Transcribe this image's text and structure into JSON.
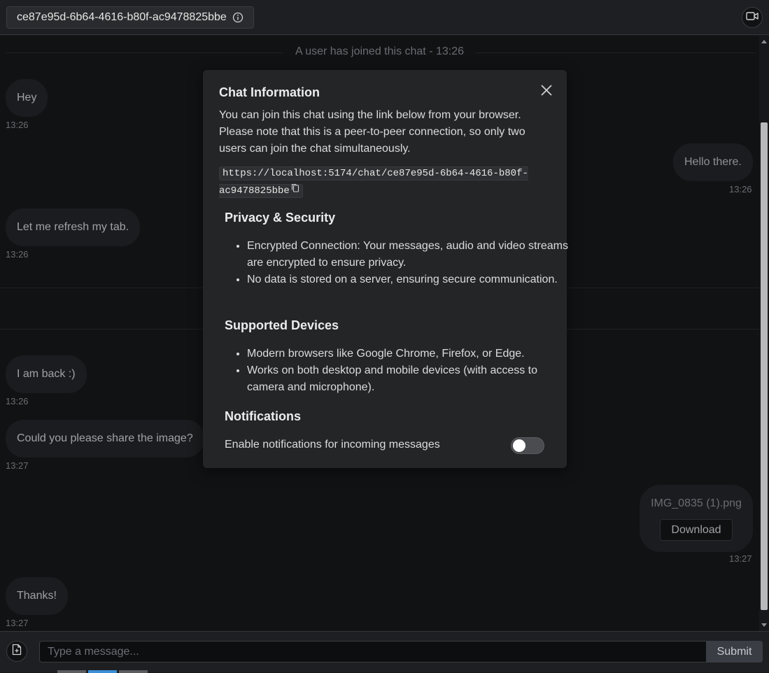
{
  "header": {
    "chat_id": "ce87e95d-6b64-4616-b80f-ac9478825bbe",
    "info_icon": "info-icon",
    "video_icon": "video-camera-icon"
  },
  "chat": {
    "system_message": "A user has joined this chat - 13:26",
    "messages": [
      {
        "side": "left",
        "text": "Hey",
        "time": "13:26"
      },
      {
        "side": "right",
        "text": "Hello there.",
        "time": "13:26"
      },
      {
        "side": "left",
        "text": "Let me refresh my tab.",
        "time": "13:26"
      },
      {
        "side": "left",
        "text": "I am back :)",
        "time": "13:26"
      },
      {
        "side": "left",
        "text": "Could you please share the image?",
        "time": "13:27"
      },
      {
        "side": "right",
        "type": "file",
        "file_name": "IMG_0835 (1).png",
        "download_label": "Download",
        "time": "13:27"
      },
      {
        "side": "left",
        "text": "Thanks!",
        "time": "13:27"
      }
    ]
  },
  "footer": {
    "attach_icon": "file-plus-icon",
    "input_placeholder": "Type a message...",
    "input_value": "",
    "submit_label": "Submit"
  },
  "modal": {
    "title": "Chat Information",
    "close_icon": "close-icon",
    "description": "You can join this chat using the link below from your browser. Please note that this is a peer-to-peer connection, so only two users can join the chat simultaneously.",
    "link": "https://localhost:5174/chat/ce87e95d-6b64-4616-b80f-ac9478825bbe",
    "copy_icon": "copy-icon",
    "sections": [
      {
        "title": "Privacy & Security",
        "items": [
          "Encrypted Connection: Your messages, audio and video streams are encrypted to ensure privacy.",
          "No data is stored on a server, ensuring secure communication."
        ]
      },
      {
        "title": "Supported Devices",
        "items": [
          "Modern browsers like Google Chrome, Firefox, or Edge.",
          "Works on both desktop and mobile devices (with access to camera and microphone)."
        ]
      }
    ],
    "notifications": {
      "title": "Notifications",
      "label": "Enable notifications for incoming messages",
      "enabled": false
    }
  },
  "colors": {
    "background": "#17181b",
    "bubble": "#24262a",
    "modal": "#242527",
    "accent_tab": "#3b8fd6"
  }
}
